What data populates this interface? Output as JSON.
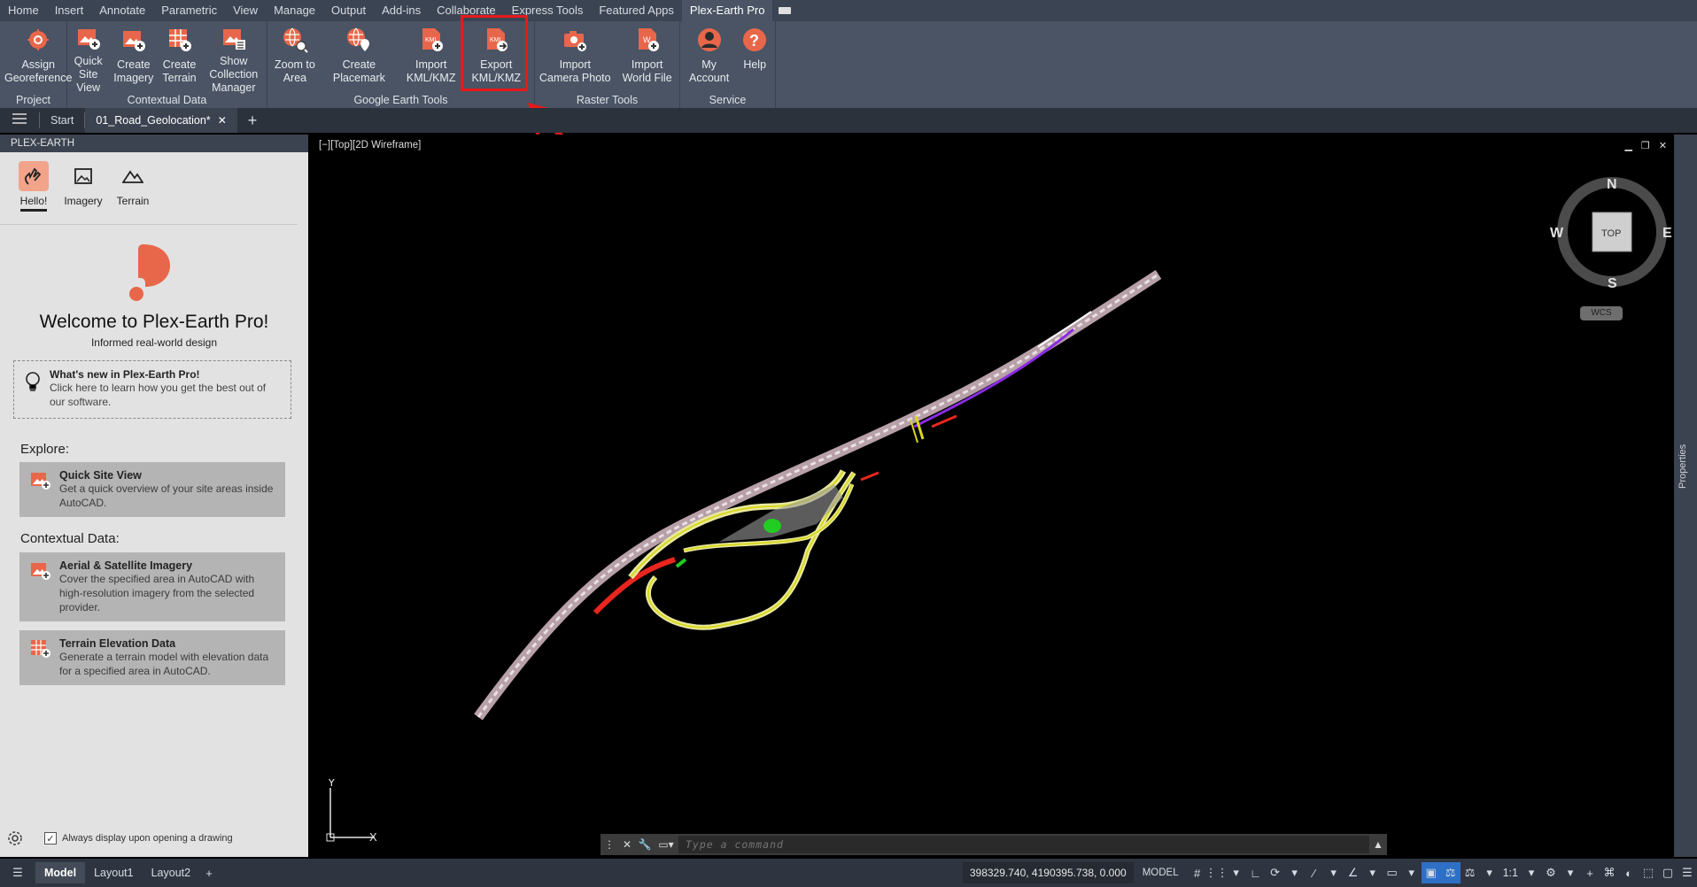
{
  "ribbon_tabs": [
    "Home",
    "Insert",
    "Annotate",
    "Parametric",
    "View",
    "Manage",
    "Output",
    "Add-ins",
    "Collaborate",
    "Express Tools",
    "Featured Apps",
    "Plex-Earth Pro"
  ],
  "ribbon": {
    "project": {
      "title": "Project",
      "assign": "Assign\nGeoreference"
    },
    "contextual": {
      "title": "Contextual Data",
      "quick_site": "Quick\nSite View",
      "create_imagery": "Create\nImagery",
      "create_terrain": "Create\nTerrain",
      "show_collection": "Show Collection\nManager"
    },
    "google_earth": {
      "title": "Google Earth Tools",
      "zoom": "Zoom to\nArea",
      "placemark": "Create\nPlacemark",
      "import_kml": "Import\nKML/KMZ",
      "export_kml": "Export\nKML/KMZ"
    },
    "raster": {
      "title": "Raster Tools",
      "import_camera": "Import\nCamera Photo",
      "import_world": "Import\nWorld File"
    },
    "service": {
      "title": "Service",
      "account": "My\nAccount",
      "help": "Help"
    }
  },
  "file_tabs": {
    "start": "Start",
    "drawing": "01_Road_Geolocation*"
  },
  "palette": {
    "header": "PLEX-EARTH",
    "tabs": [
      "Hello!",
      "Imagery",
      "Terrain"
    ],
    "welcome_title": "Welcome to Plex-Earth Pro!",
    "welcome_sub": "Informed real-world design",
    "whatsnew_title": "What's new in Plex-Earth Pro!",
    "whatsnew_desc": "Click here to learn how you get the best out of our software.",
    "explore": "Explore:",
    "quick_site_title": "Quick Site View",
    "quick_site_desc": "Get a quick overview of your site areas inside AutoCAD.",
    "contextual": "Contextual Data:",
    "aerial_title": "Aerial & Satellite Imagery",
    "aerial_desc": "Cover the specified area in AutoCAD with high-resolution imagery from the selected provider.",
    "terrain_title": "Terrain Elevation Data",
    "terrain_desc": "Generate a terrain model with elevation data for a specified area in AutoCAD.",
    "footer_check": "Always display upon opening a drawing"
  },
  "viewport": {
    "label": "[−][Top][2D Wireframe]",
    "compass": {
      "n": "N",
      "s": "S",
      "e": "E",
      "w": "W",
      "top": "TOP"
    },
    "wcs": "WCS",
    "ucs_y": "Y",
    "ucs_x": "X",
    "command_placeholder": "Type a command"
  },
  "props_label": "Properties",
  "status": {
    "tabs": [
      "Model",
      "Layout1",
      "Layout2"
    ],
    "coords": "398329.740, 4190395.738, 0.000",
    "model": "MODEL",
    "scale": "1:1"
  },
  "colors": {
    "accent": "#e8674a",
    "highlight": "#e8191b",
    "ribbon": "#4a5464"
  }
}
